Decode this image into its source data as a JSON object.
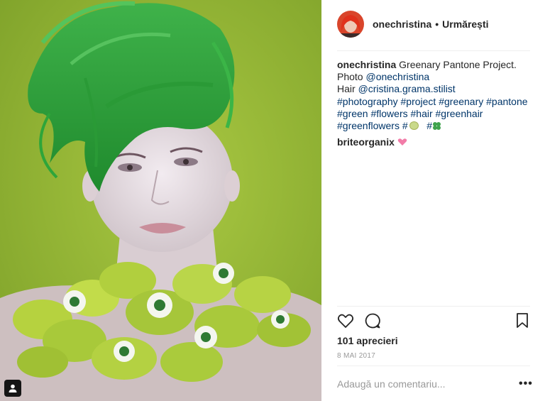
{
  "post": {
    "username": "onechristina",
    "dot": "•",
    "follow_label": "Urmărești"
  },
  "caption": {
    "username": "onechristina",
    "line1_text": " Greenary Pantone Project.",
    "photo_prefix": "Photo ",
    "photo_mention": "@onechristina",
    "hair_prefix": "Hair ",
    "hair_mention": "@cristina.grama.stilist",
    "hashtags_line1": "#photography #project #greenary #pantone",
    "hashtags_line2": "#green #flowers #hair #greenhair",
    "hashtags_line3a": "#greenflowers #",
    "hashtags_line3b": "#"
  },
  "comment": {
    "username": "briteorganix",
    "emoji": "💕"
  },
  "stats": {
    "likes": "101 aprecieri",
    "date": "8 MAI 2017"
  },
  "add_comment": {
    "placeholder": "Adaugă un comentariu..."
  },
  "icons": {
    "like": "heart-icon",
    "comment": "comment-icon",
    "save": "bookmark-icon",
    "more": "more-options-icon",
    "tag": "user-tag-icon"
  },
  "colors": {
    "text": "#262626",
    "link": "#003569",
    "muted": "#999999",
    "divider": "#efefef",
    "background_green": "#93b938"
  }
}
